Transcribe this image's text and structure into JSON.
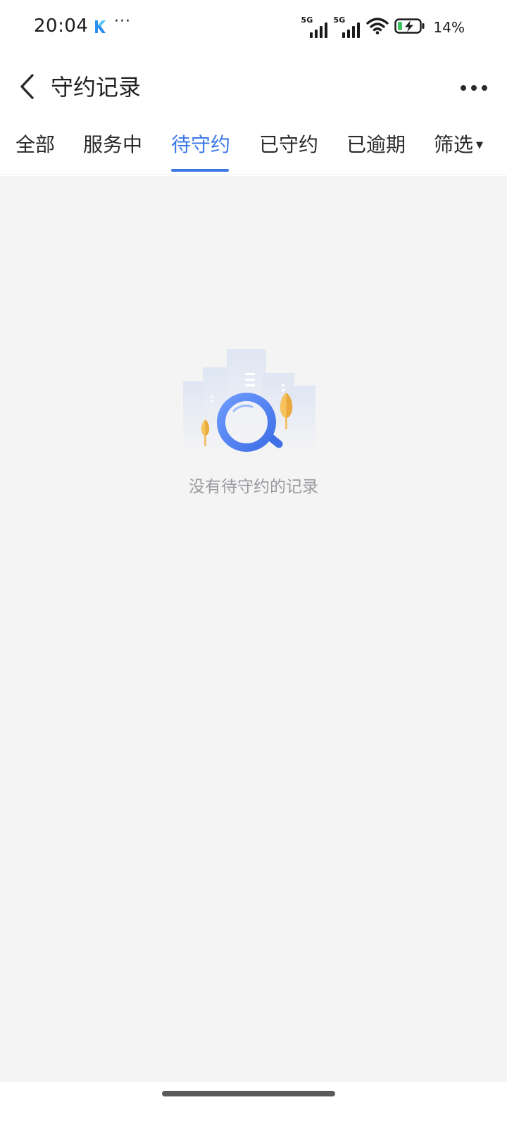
{
  "status_bar": {
    "time": "20:04",
    "app_icon": "k-app-icon",
    "dots": "···",
    "signal_1_tag": "5G",
    "signal_2_tag": "5G",
    "wifi_icon": "wifi-icon",
    "battery_icon": "battery-charging-icon",
    "battery_percent": "14%"
  },
  "header": {
    "back_icon": "back-arrow-icon",
    "title": "守约记录",
    "more_icon": "more-dots-icon"
  },
  "tabs": [
    {
      "label": "全部"
    },
    {
      "label": "服务中"
    },
    {
      "label": "待守约",
      "active": true
    },
    {
      "label": "已守约"
    },
    {
      "label": "已逾期"
    },
    {
      "label": "筛选"
    }
  ],
  "empty_state": {
    "illustration": "empty-search-illustration",
    "message": "没有待守约的记录"
  },
  "colors": {
    "accent": "#3a77e6",
    "background": "#f4f4f5",
    "header_bg": "#ffffff",
    "empty_text": "#999a9e"
  }
}
